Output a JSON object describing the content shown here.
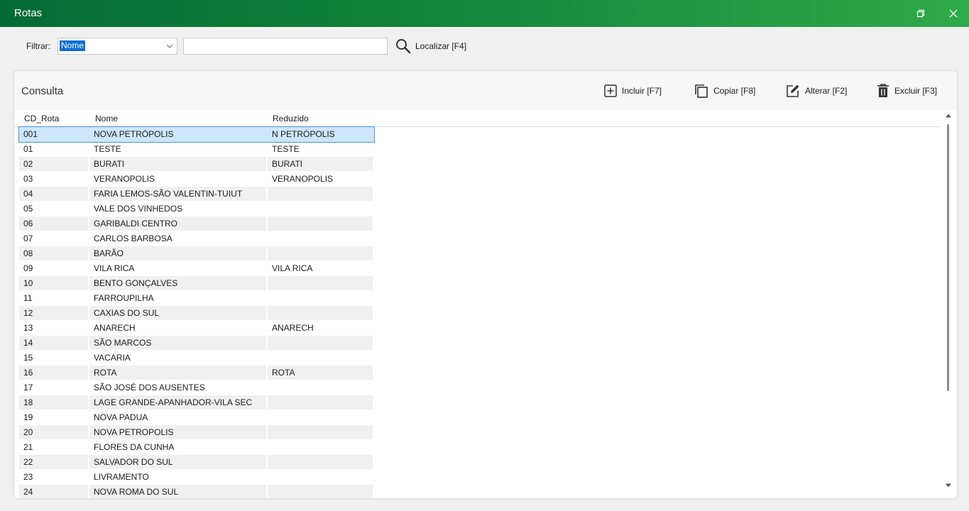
{
  "window": {
    "title": "Rotas"
  },
  "filter": {
    "label": "Filtrar:",
    "selected": "Nome",
    "search_value": "",
    "find_label": "Localizar [F4]"
  },
  "panel": {
    "title": "Consulta",
    "actions": {
      "add": "Incluir [F7]",
      "copy": "Copiar [F8]",
      "edit": "Alterar [F2]",
      "delete": "Excluir [F3]"
    }
  },
  "table": {
    "columns": [
      "CD_Rota",
      "Nome",
      "Reduzido"
    ],
    "rows": [
      [
        "001",
        "NOVA PETRÓPOLIS",
        "N PETRÓPOLIS"
      ],
      [
        "01",
        "TESTE",
        "TESTE"
      ],
      [
        "02",
        "BURATI",
        "BURATI"
      ],
      [
        "03",
        "VERANOPOLIS",
        "VERANOPOLIS"
      ],
      [
        "04",
        "FARIA LEMOS-SÃO VALENTIN-TUIUT",
        ""
      ],
      [
        "05",
        "VALE DOS VINHEDOS",
        ""
      ],
      [
        "06",
        "GARIBALDI CENTRO",
        ""
      ],
      [
        "07",
        "CARLOS BARBOSA",
        ""
      ],
      [
        "08",
        "BARÃO",
        ""
      ],
      [
        "09",
        "VILA RICA",
        "VILA RICA"
      ],
      [
        "10",
        "BENTO GONÇALVES",
        ""
      ],
      [
        "11",
        "FARROUPILHA",
        ""
      ],
      [
        "12",
        "CAXIAS DO SUL",
        ""
      ],
      [
        "13",
        "ANARECH",
        "ANARECH"
      ],
      [
        "14",
        "SÃO MARCOS",
        ""
      ],
      [
        "15",
        "VACARIA",
        ""
      ],
      [
        "16",
        "ROTA",
        "ROTA"
      ],
      [
        "17",
        "SÃO JOSÉ DOS AUSENTES",
        ""
      ],
      [
        "18",
        "LAGE GRANDE-APANHADOR-VILA SEC",
        ""
      ],
      [
        "19",
        "NOVA PADUA",
        ""
      ],
      [
        "20",
        "NOVA PETROPOLIS",
        ""
      ],
      [
        "21",
        "FLORES DA CUNHA",
        ""
      ],
      [
        "22",
        "SALVADOR DO SUL",
        ""
      ],
      [
        "23",
        "LIVRAMENTO",
        ""
      ],
      [
        "24",
        "NOVA ROMA DO SUL",
        ""
      ]
    ],
    "selected_index": 0
  }
}
